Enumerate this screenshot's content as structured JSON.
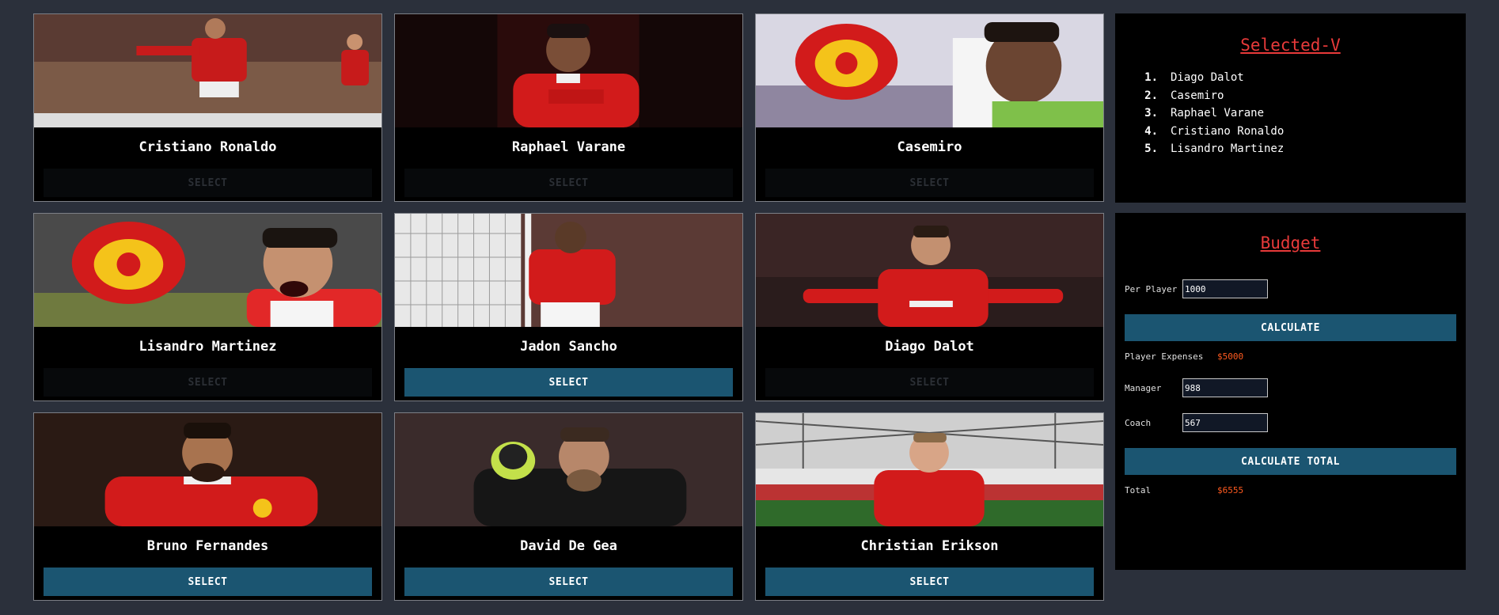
{
  "players": [
    {
      "name": "Cristiano Ronaldo",
      "button": "SELECT",
      "enabled": false
    },
    {
      "name": "Raphael Varane",
      "button": "SELECT",
      "enabled": false
    },
    {
      "name": "Casemiro",
      "button": "SELECT",
      "enabled": false
    },
    {
      "name": "Lisandro Martinez",
      "button": "SELECT",
      "enabled": false
    },
    {
      "name": "Jadon Sancho",
      "button": "SELECT",
      "enabled": true
    },
    {
      "name": "Diago Dalot",
      "button": "SELECT",
      "enabled": false
    },
    {
      "name": "Bruno Fernandes",
      "button": "SELECT",
      "enabled": true
    },
    {
      "name": "David De Gea",
      "button": "SELECT",
      "enabled": true
    },
    {
      "name": "Christian Erikson",
      "button": "SELECT",
      "enabled": true
    }
  ],
  "selected": {
    "title": "Selected-V",
    "items": [
      {
        "num": "1.",
        "name": "Diago Dalot"
      },
      {
        "num": "2.",
        "name": "Casemiro"
      },
      {
        "num": "3.",
        "name": "Raphael Varane"
      },
      {
        "num": "4.",
        "name": "Cristiano Ronaldo"
      },
      {
        "num": "5.",
        "name": "Lisandro Martinez"
      }
    ]
  },
  "budget": {
    "title": "Budget",
    "per_player_label": "Per Player",
    "per_player_value": "1000",
    "calculate_label": "CALCULATE",
    "player_expenses_label": "Player Expenses",
    "player_expenses_value": "$5000",
    "manager_label": "Manager",
    "manager_value": "988",
    "coach_label": "Coach",
    "coach_value": "567",
    "calculate_total_label": "CALCULATE TOTAL",
    "total_label": "Total",
    "total_value": "$6555"
  },
  "colors": {
    "page_bg": "#2b303b",
    "accent_button": "#1b5571",
    "title_red": "#e83a3a",
    "money_orange": "#ff5a1f"
  }
}
